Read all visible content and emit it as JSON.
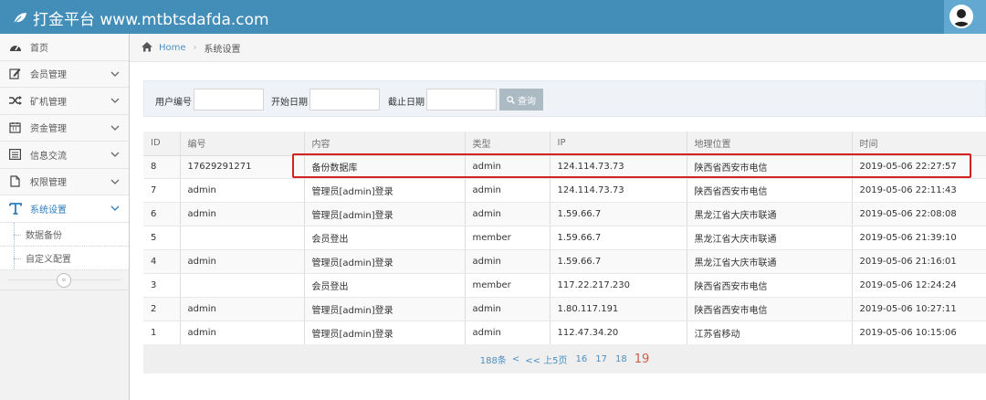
{
  "header": {
    "brand": "打金平台 www.mtbtsdafda.com",
    "brand_icon": "leaf-icon",
    "accent": "#438eb9"
  },
  "sidebar": {
    "items": [
      {
        "label": "首页",
        "icon": "tachometer-icon",
        "has_chevron": false
      },
      {
        "label": "会员管理",
        "icon": "edit-icon",
        "has_chevron": true
      },
      {
        "label": "矿机管理",
        "icon": "shuffle-icon",
        "has_chevron": true
      },
      {
        "label": "资金管理",
        "icon": "calendar-icon",
        "has_chevron": true
      },
      {
        "label": "信息交流",
        "icon": "list-icon",
        "has_chevron": true
      },
      {
        "label": "权限管理",
        "icon": "file-icon",
        "has_chevron": true
      },
      {
        "label": "系统设置",
        "icon": "text-icon",
        "has_chevron": true,
        "active": true
      }
    ],
    "subitems": [
      "数据备份",
      "自定义配置"
    ],
    "collapse": "«"
  },
  "breadcrumb": {
    "home": "Home",
    "current": "系统设置"
  },
  "search": {
    "user_label": "用户编号",
    "start_label": "开始日期",
    "end_label": "截止日期",
    "button": "查询"
  },
  "table": {
    "headers": [
      "ID",
      "编号",
      "内容",
      "类型",
      "IP",
      "地理位置",
      "时间"
    ],
    "rows": [
      [
        "8",
        "17629291271",
        "备份数据库",
        "admin",
        "124.114.73.73",
        "陕西省西安市电信",
        "2019-05-06 22:27:57"
      ],
      [
        "7",
        "admin",
        "管理员[admin]登录",
        "admin",
        "124.114.73.73",
        "陕西省西安市电信",
        "2019-05-06 22:11:43"
      ],
      [
        "6",
        "admin",
        "管理员[admin]登录",
        "admin",
        "1.59.66.7",
        "黑龙江省大庆市联通",
        "2019-05-06 22:08:08"
      ],
      [
        "5",
        "",
        "会员登出",
        "member",
        "1.59.66.7",
        "黑龙江省大庆市联通",
        "2019-05-06 21:39:10"
      ],
      [
        "4",
        "admin",
        "管理员[admin]登录",
        "admin",
        "1.59.66.7",
        "黑龙江省大庆市联通",
        "2019-05-06 21:16:01"
      ],
      [
        "3",
        "",
        "会员登出",
        "member",
        "117.22.217.230",
        "陕西省西安市电信",
        "2019-05-06 12:24:24"
      ],
      [
        "2",
        "admin",
        "管理员[admin]登录",
        "admin",
        "1.80.117.191",
        "陕西省西安市电信",
        "2019-05-06 10:27:11"
      ],
      [
        "1",
        "admin",
        "管理员[admin]登录",
        "admin",
        "112.47.34.20",
        "江苏省移动",
        "2019-05-06 10:15:06"
      ]
    ]
  },
  "pager": {
    "total": "188条",
    "prev": "<",
    "prev5": "<< 上5页",
    "pages": [
      "16",
      "17",
      "18"
    ],
    "current": "19"
  }
}
